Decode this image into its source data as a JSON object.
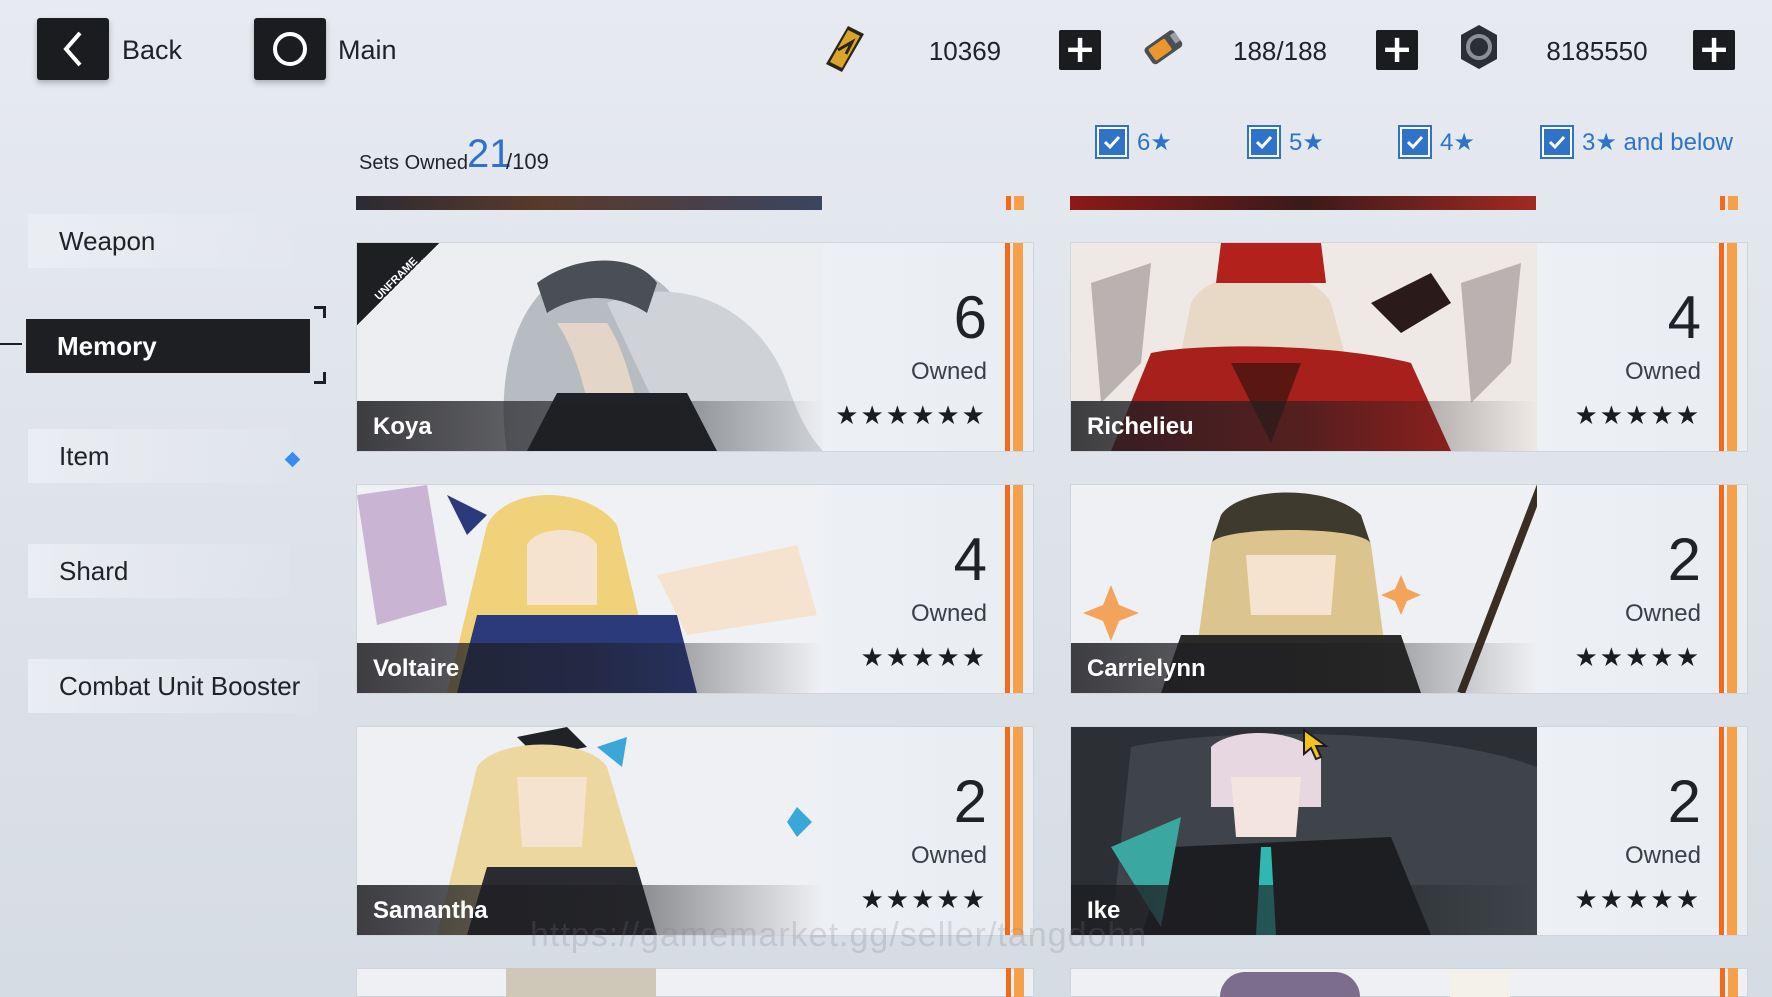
{
  "topbar": {
    "back_label": "Back",
    "main_label": "Main",
    "resources": [
      {
        "icon": "gold-bar-icon",
        "value": "10369"
      },
      {
        "icon": "battery-icon",
        "value": "188/188"
      },
      {
        "icon": "coin-icon",
        "value": "8185550"
      }
    ]
  },
  "sidebar": {
    "items": [
      {
        "label": "Weapon"
      },
      {
        "label": "Memory",
        "active": true
      },
      {
        "label": "Item",
        "has_badge": true
      },
      {
        "label": "Shard"
      },
      {
        "label": "Combat Unit Booster"
      }
    ]
  },
  "collection": {
    "sets_label": "Sets Owned",
    "sets_owned": "21",
    "sets_total": "/109"
  },
  "filters": [
    {
      "label": "6★",
      "checked": true
    },
    {
      "label": "5★",
      "checked": true
    },
    {
      "label": "4★",
      "checked": true
    },
    {
      "label": "3★ and below",
      "checked": true
    }
  ],
  "cards": [
    {
      "name": "Koya",
      "count": "6",
      "owned_label": "Owned",
      "stars": "★★★★★★",
      "tag": "UNFRAME"
    },
    {
      "name": "Richelieu",
      "count": "4",
      "owned_label": "Owned",
      "stars": "★★★★★"
    },
    {
      "name": "Voltaire",
      "count": "4",
      "owned_label": "Owned",
      "stars": "★★★★★"
    },
    {
      "name": "Carrielynn",
      "count": "2",
      "owned_label": "Owned",
      "stars": "★★★★★"
    },
    {
      "name": "Samantha",
      "count": "2",
      "owned_label": "Owned",
      "stars": "★★★★★"
    },
    {
      "name": "Ike",
      "count": "2",
      "owned_label": "Owned",
      "stars": "★★★★★"
    }
  ],
  "watermark": "https://gamemarket.gg/seller/tangdohn",
  "colors": {
    "accent_blue": "#2f73c8",
    "stripe_orange": "#f26b1d",
    "button_dark": "#1b1c1f",
    "badge_blue": "#3a8bf0"
  }
}
